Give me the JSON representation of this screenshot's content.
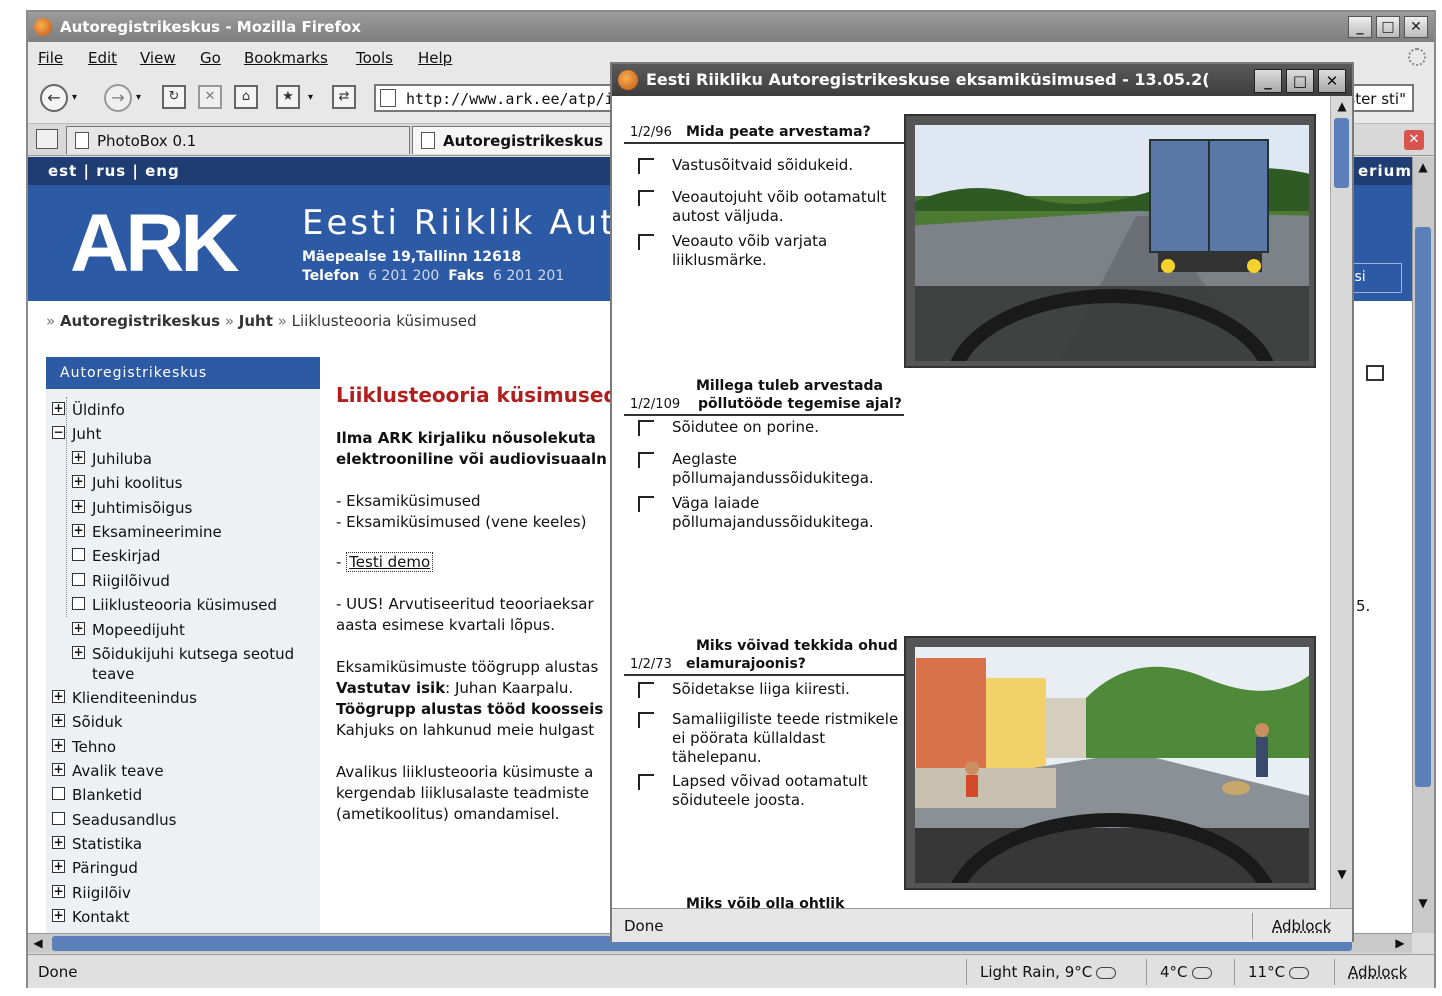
{
  "browser": {
    "title": "Autoregistrikeskus - Mozilla Firefox",
    "menu": [
      "File",
      "Edit",
      "View",
      "Go",
      "Bookmarks",
      "Tools",
      "Help"
    ],
    "url": "http://www.ark.ee/atp/in",
    "url_tail": "ster sti\"",
    "tabs": [
      "PhotoBox 0.1",
      "Autoregistrikeskus"
    ],
    "status": "Done",
    "weather": [
      "Light Rain, 9°C",
      "4°C",
      "11°C"
    ],
    "adblock": "Adblock"
  },
  "site": {
    "langs": "est | rus | eng",
    "langs_right": "erium",
    "logo": "ARK",
    "title": "Eesti Riiklik Autor",
    "address": "Mäepealse 19,Tallinn 12618",
    "phone_label": "Telefon",
    "phone": "6 201 200",
    "fax_label": "Faks",
    "fax": "6 201 201",
    "banner_button": "tsi",
    "breadcrumb": [
      "Autoregistrikeskus",
      "Juht",
      "Liiklusteooria küsimused"
    ],
    "right_text": "5."
  },
  "sidebar": {
    "heading": "Autoregistrikeskus",
    "items": [
      {
        "label": "Üldinfo",
        "sign": "+"
      },
      {
        "label": "Juht",
        "sign": "−"
      },
      {
        "label": "Juhiluba",
        "sign": "+"
      },
      {
        "label": "Juhi koolitus",
        "sign": "+"
      },
      {
        "label": "Juhtimisõigus",
        "sign": "+"
      },
      {
        "label": "Eksamineerimine",
        "sign": "+"
      },
      {
        "label": "Eeskirjad",
        "sign": ""
      },
      {
        "label": "Riigilõivud",
        "sign": ""
      },
      {
        "label": "Liiklusteooria küsimused",
        "sign": ""
      },
      {
        "label": "Mopeedijuht",
        "sign": "+"
      },
      {
        "label": "Sõidukijuhi kutsega seotud",
        "sign": "+"
      },
      {
        "label": "teave",
        "sign": ""
      },
      {
        "label": "Klienditeenindus",
        "sign": "+"
      },
      {
        "label": "Sõiduk",
        "sign": "+"
      },
      {
        "label": "Tehno",
        "sign": "+"
      },
      {
        "label": "Avalik teave",
        "sign": "+"
      },
      {
        "label": "Blanketid",
        "sign": ""
      },
      {
        "label": "Seadusandlus",
        "sign": ""
      },
      {
        "label": "Statistika",
        "sign": "+"
      },
      {
        "label": "Päringud",
        "sign": "+"
      },
      {
        "label": "Riigilõiv",
        "sign": "+"
      },
      {
        "label": "Kontakt",
        "sign": "+"
      }
    ]
  },
  "main": {
    "title": "Liiklusteooria küsimused",
    "bold1": "Ilma ARK kirjaliku nõusolekuta",
    "bold2": "elektrooniline või audiovisuaaln",
    "link1": "- Eksamiküsimused",
    "link2": "- Eksamiküsimused (vene keeles)",
    "dash": "- ",
    "demo": "Testi demo",
    "news1": "- UUS! Arvutiseeritud teooriaeksar",
    "news2": "aasta esimese kvartali lõpus.",
    "p1": "Eksamiküsimuste töögrupp alustas",
    "p2_label": "Vastutav isik",
    "p2": ": Juhan Kaarpalu.",
    "p3": "Töögrupp alustas tööd koosseis",
    "p4": "Kahjuks on lahkunud meie hulgast",
    "p5": "Avalikus liiklusteooria küsimuste a",
    "p6": "kergendab liiklusalaste teadmiste",
    "p7": "(ametikoolitus) omandamisel."
  },
  "popup": {
    "title": "Eesti Riikliku Autoregistrikeskuse eksamiküsimused - 13.05.2(",
    "status": "Done",
    "adblock": "Adblock",
    "questions": [
      {
        "num": "1/2/96",
        "text": "Mida peate arvestama?",
        "options": [
          "Vastusõitvaid sõidukeid.",
          "Veoautojuht võib ootamatult autost väljuda.",
          "Veoauto võib varjata liiklusmärke."
        ]
      },
      {
        "num": "1/2/109",
        "text_line1": "Millega tuleb arvestada",
        "text_line2": "põllutööde tegemise ajal?",
        "options": [
          "Sõidutee on porine.",
          "Aeglaste põllumajandussõidukitega.",
          "Väga laiade põllumajandussõidukitega."
        ]
      },
      {
        "num": "1/2/73",
        "text_line1": "Miks võivad tekkida ohud",
        "text_line2": "elamurajoonis?",
        "options": [
          "Sõidetakse liiga kiiresti.",
          "Samaliigiliste teede ristmikele ei pöörata küllaldast tähelepanu.",
          "Lapsed võivad ootamatult sõiduteele joosta."
        ]
      }
    ],
    "cut_text": "Miks võib olla ohtlik"
  },
  "colors": {
    "ark_blue": "#2d5aa5",
    "ark_dark": "#1f3d72",
    "title_red": "#b11e1e",
    "scroll_thumb": "#5b7fb8"
  }
}
